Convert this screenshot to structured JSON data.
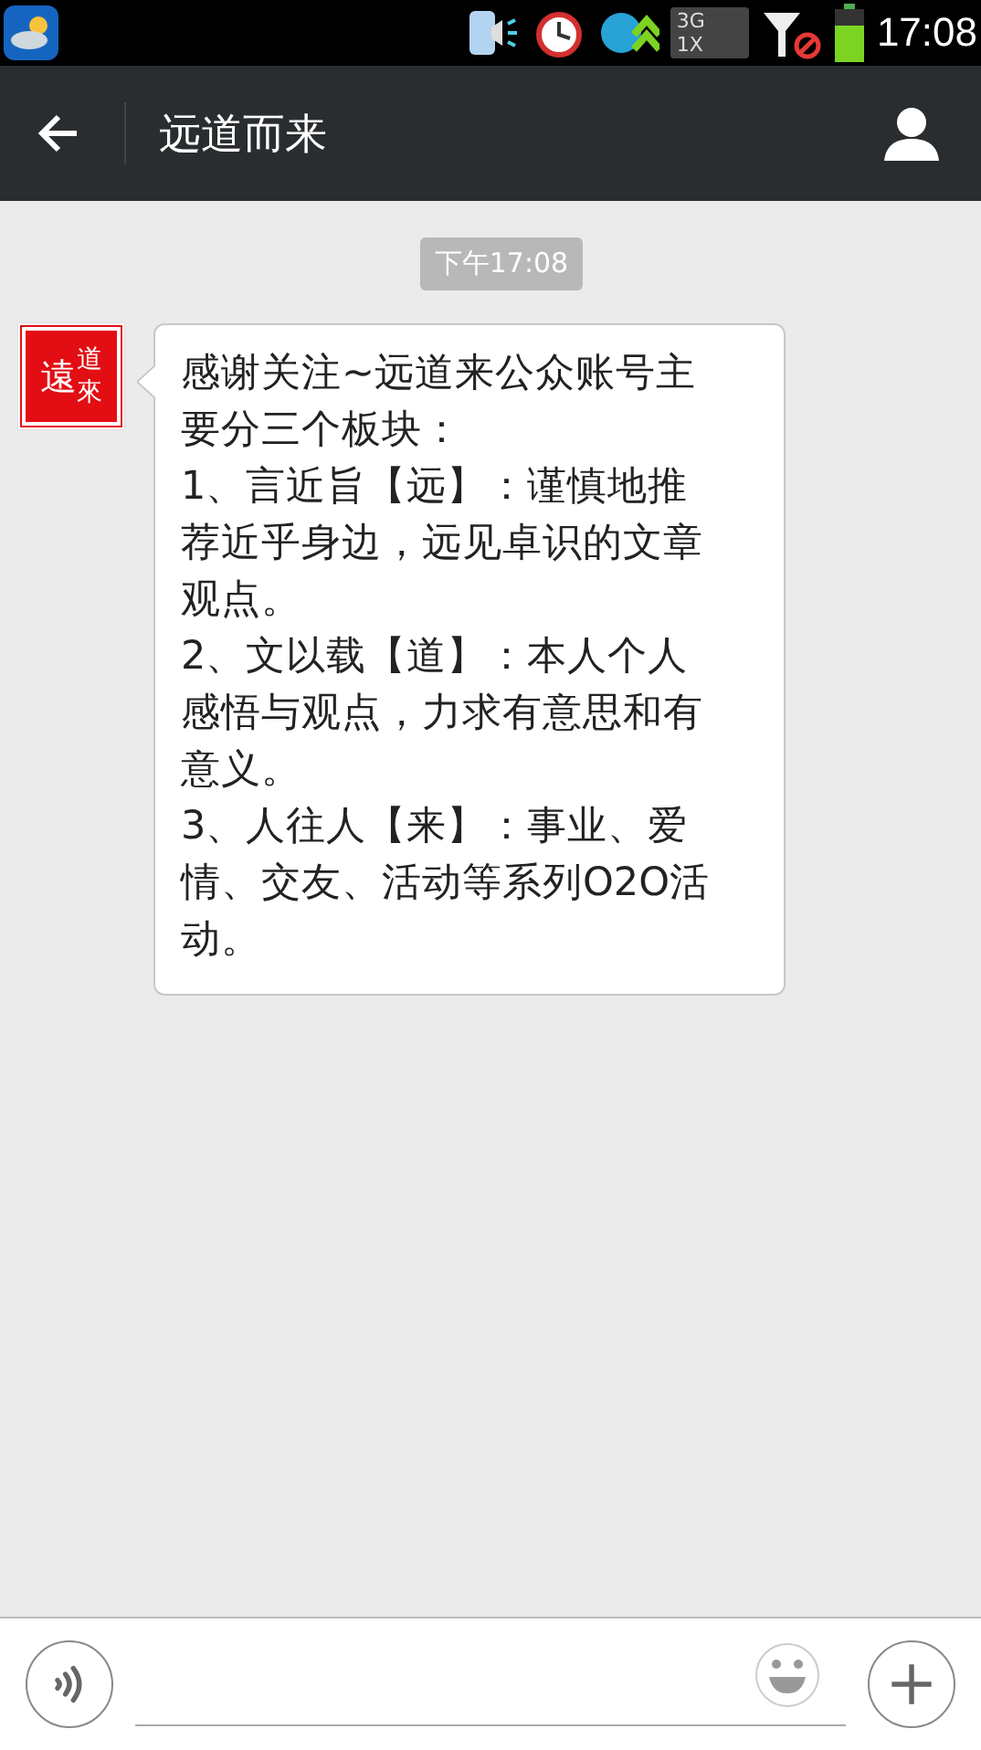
{
  "status_bar": {
    "network_top": "3G",
    "network_bottom": "1X",
    "time": "17:08"
  },
  "header": {
    "title": "远道而来"
  },
  "chat": {
    "timestamp": "下午17:08",
    "messages": [
      {
        "avatar": {
          "left": "遠",
          "top_right": "道",
          "bottom_right": "來"
        },
        "paragraphs": [
          "感谢关注~远道来公众账号主要分三个板块：",
          "1、言近旨【远】：谨慎地推荐近乎身边，远见卓识的文章观点。",
          "2、文以载【道】：本人个人感悟与观点，力求有意思和有意义。",
          "3、人往人【来】：事业、爱情、交友、活动等系列O2O活动。"
        ]
      }
    ]
  }
}
